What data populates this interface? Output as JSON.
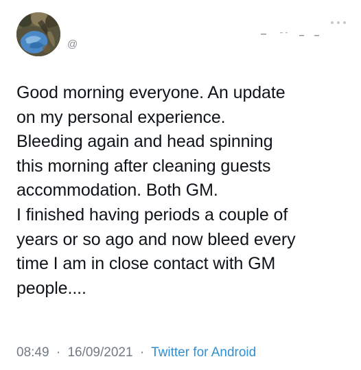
{
  "tweet": {
    "handle": "@",
    "body": "Good morning everyone. An update\non my personal experience.\nBleeding again and head spinning\nthis morning after cleaning guests\naccommodation. Both GM.\nI finished having periods a couple of\nyears or so ago and now bleed every\ntime I am in close contact with GM\npeople....",
    "time": "08:49",
    "date": "16/09/2021",
    "separator": "·",
    "source": "Twitter for Android"
  },
  "icons": {
    "avatar": "profile-photo",
    "more": "more-options-icon"
  },
  "colors": {
    "text": "#0f1419",
    "muted": "#6f7a84",
    "link": "#2f8fd2",
    "icon": "#c3c8cc"
  }
}
